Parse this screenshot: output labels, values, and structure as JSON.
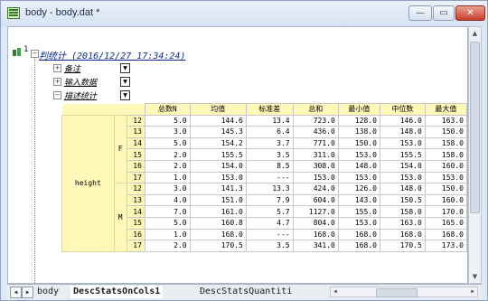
{
  "window": {
    "title": "body - body.dat *",
    "min_glyph": "—",
    "max_glyph": "▭",
    "close_glyph": "✕"
  },
  "report": {
    "row_number": "1",
    "title": "判统计 (2016/12/27 17:34:24)"
  },
  "tree": {
    "nodes": [
      "备注",
      "输入数据",
      "描述统计"
    ]
  },
  "table": {
    "headers": [
      "总数N",
      "均值",
      "标准差",
      "总和",
      "最小值",
      "中位数",
      "最大值"
    ],
    "group_label": "height",
    "subgroups": [
      "F",
      "M"
    ],
    "rows": [
      {
        "obs": "12",
        "v": [
          "5.0",
          "144.6",
          "13.4",
          "723.0",
          "128.0",
          "146.0",
          "163.0"
        ]
      },
      {
        "obs": "13",
        "v": [
          "3.0",
          "145.3",
          "6.4",
          "436.0",
          "138.0",
          "148.0",
          "150.0"
        ]
      },
      {
        "obs": "14",
        "v": [
          "5.0",
          "154.2",
          "3.7",
          "771.0",
          "150.0",
          "153.0",
          "158.0"
        ]
      },
      {
        "obs": "15",
        "v": [
          "2.0",
          "155.5",
          "3.5",
          "311.0",
          "153.0",
          "155.5",
          "158.0"
        ]
      },
      {
        "obs": "16",
        "v": [
          "2.0",
          "154.0",
          "8.5",
          "308.0",
          "148.0",
          "154.0",
          "160.0"
        ]
      },
      {
        "obs": "17",
        "v": [
          "1.0",
          "153.0",
          "---",
          "153.0",
          "153.0",
          "153.0",
          "153.0"
        ]
      },
      {
        "obs": "12",
        "v": [
          "3.0",
          "141.3",
          "13.3",
          "424.0",
          "126.0",
          "148.0",
          "150.0"
        ]
      },
      {
        "obs": "13",
        "v": [
          "4.0",
          "151.0",
          "7.9",
          "604.0",
          "143.0",
          "150.5",
          "160.0"
        ]
      },
      {
        "obs": "14",
        "v": [
          "7.0",
          "161.0",
          "5.7",
          "1127.0",
          "155.0",
          "158.0",
          "170.0"
        ]
      },
      {
        "obs": "15",
        "v": [
          "5.0",
          "160.8",
          "4.7",
          "804.0",
          "153.0",
          "163.0",
          "165.0"
        ]
      },
      {
        "obs": "16",
        "v": [
          "1.0",
          "168.0",
          "---",
          "168.0",
          "168.0",
          "168.0",
          "168.0"
        ]
      },
      {
        "obs": "17",
        "v": [
          "2.0",
          "170.5",
          "3.5",
          "341.0",
          "168.0",
          "170.5",
          "173.0"
        ]
      }
    ]
  },
  "sheets": {
    "tabs": [
      "body",
      "DescStatsOnCols1",
      "DescStatsQuantiti"
    ]
  },
  "scroll": {
    "up": "▲",
    "down": "▼",
    "left": "◀",
    "right": "▶"
  }
}
